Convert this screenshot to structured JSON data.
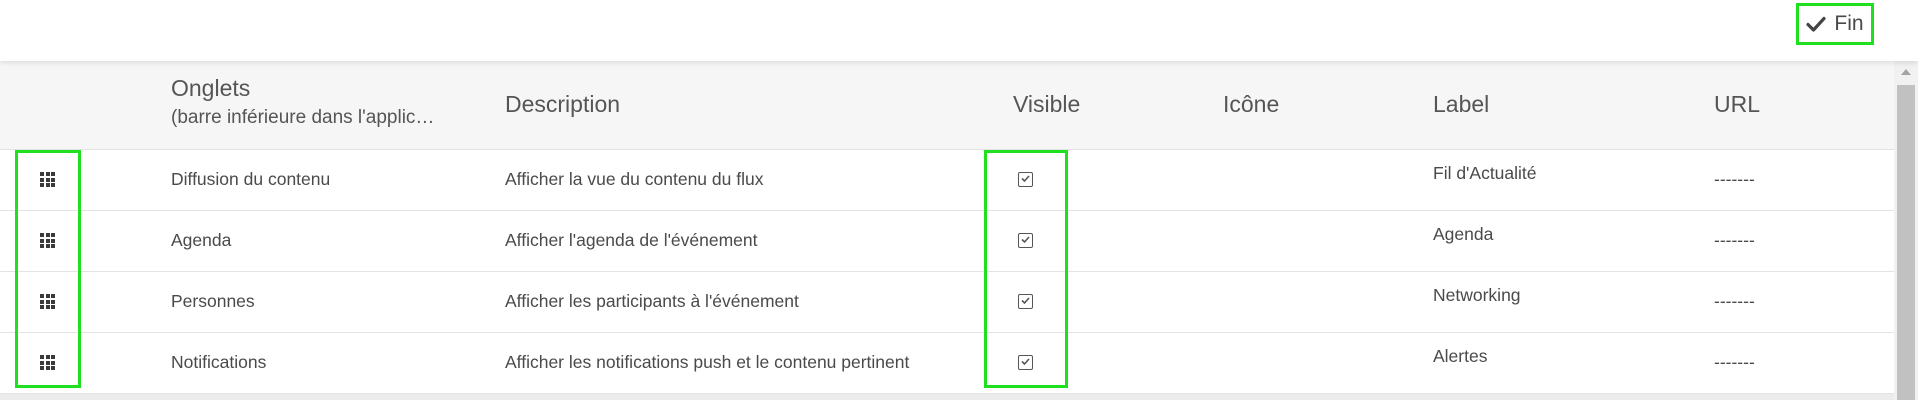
{
  "toolbar": {
    "done_label": "Fin",
    "done_icon": "check-icon"
  },
  "table": {
    "headers": {
      "tabs": "Onglets",
      "tabs_sub": "(barre inférieure dans l'applic…",
      "description": "Description",
      "visible": "Visible",
      "icon": "Icône",
      "label": "Label",
      "url": "URL"
    },
    "rows": [
      {
        "tab": "Diffusion du contenu",
        "description": "Afficher la vue du contenu du flux",
        "visible": true,
        "label": "Fil d'Actualité",
        "url": "-------"
      },
      {
        "tab": "Agenda",
        "description": "Afficher l'agenda de l'événement",
        "visible": true,
        "label": "Agenda",
        "url": "-------"
      },
      {
        "tab": "Personnes",
        "description": "Afficher les participants à l'événement",
        "visible": true,
        "label": "Networking",
        "url": "-------"
      },
      {
        "tab": "Notifications",
        "description": "Afficher les notifications push et le contenu pertinent",
        "visible": true,
        "label": "Alertes",
        "url": "-------"
      }
    ]
  },
  "colors": {
    "highlight": "#1ee01e",
    "header_bg": "#f6f6f6",
    "text": "#4a4a4a"
  }
}
